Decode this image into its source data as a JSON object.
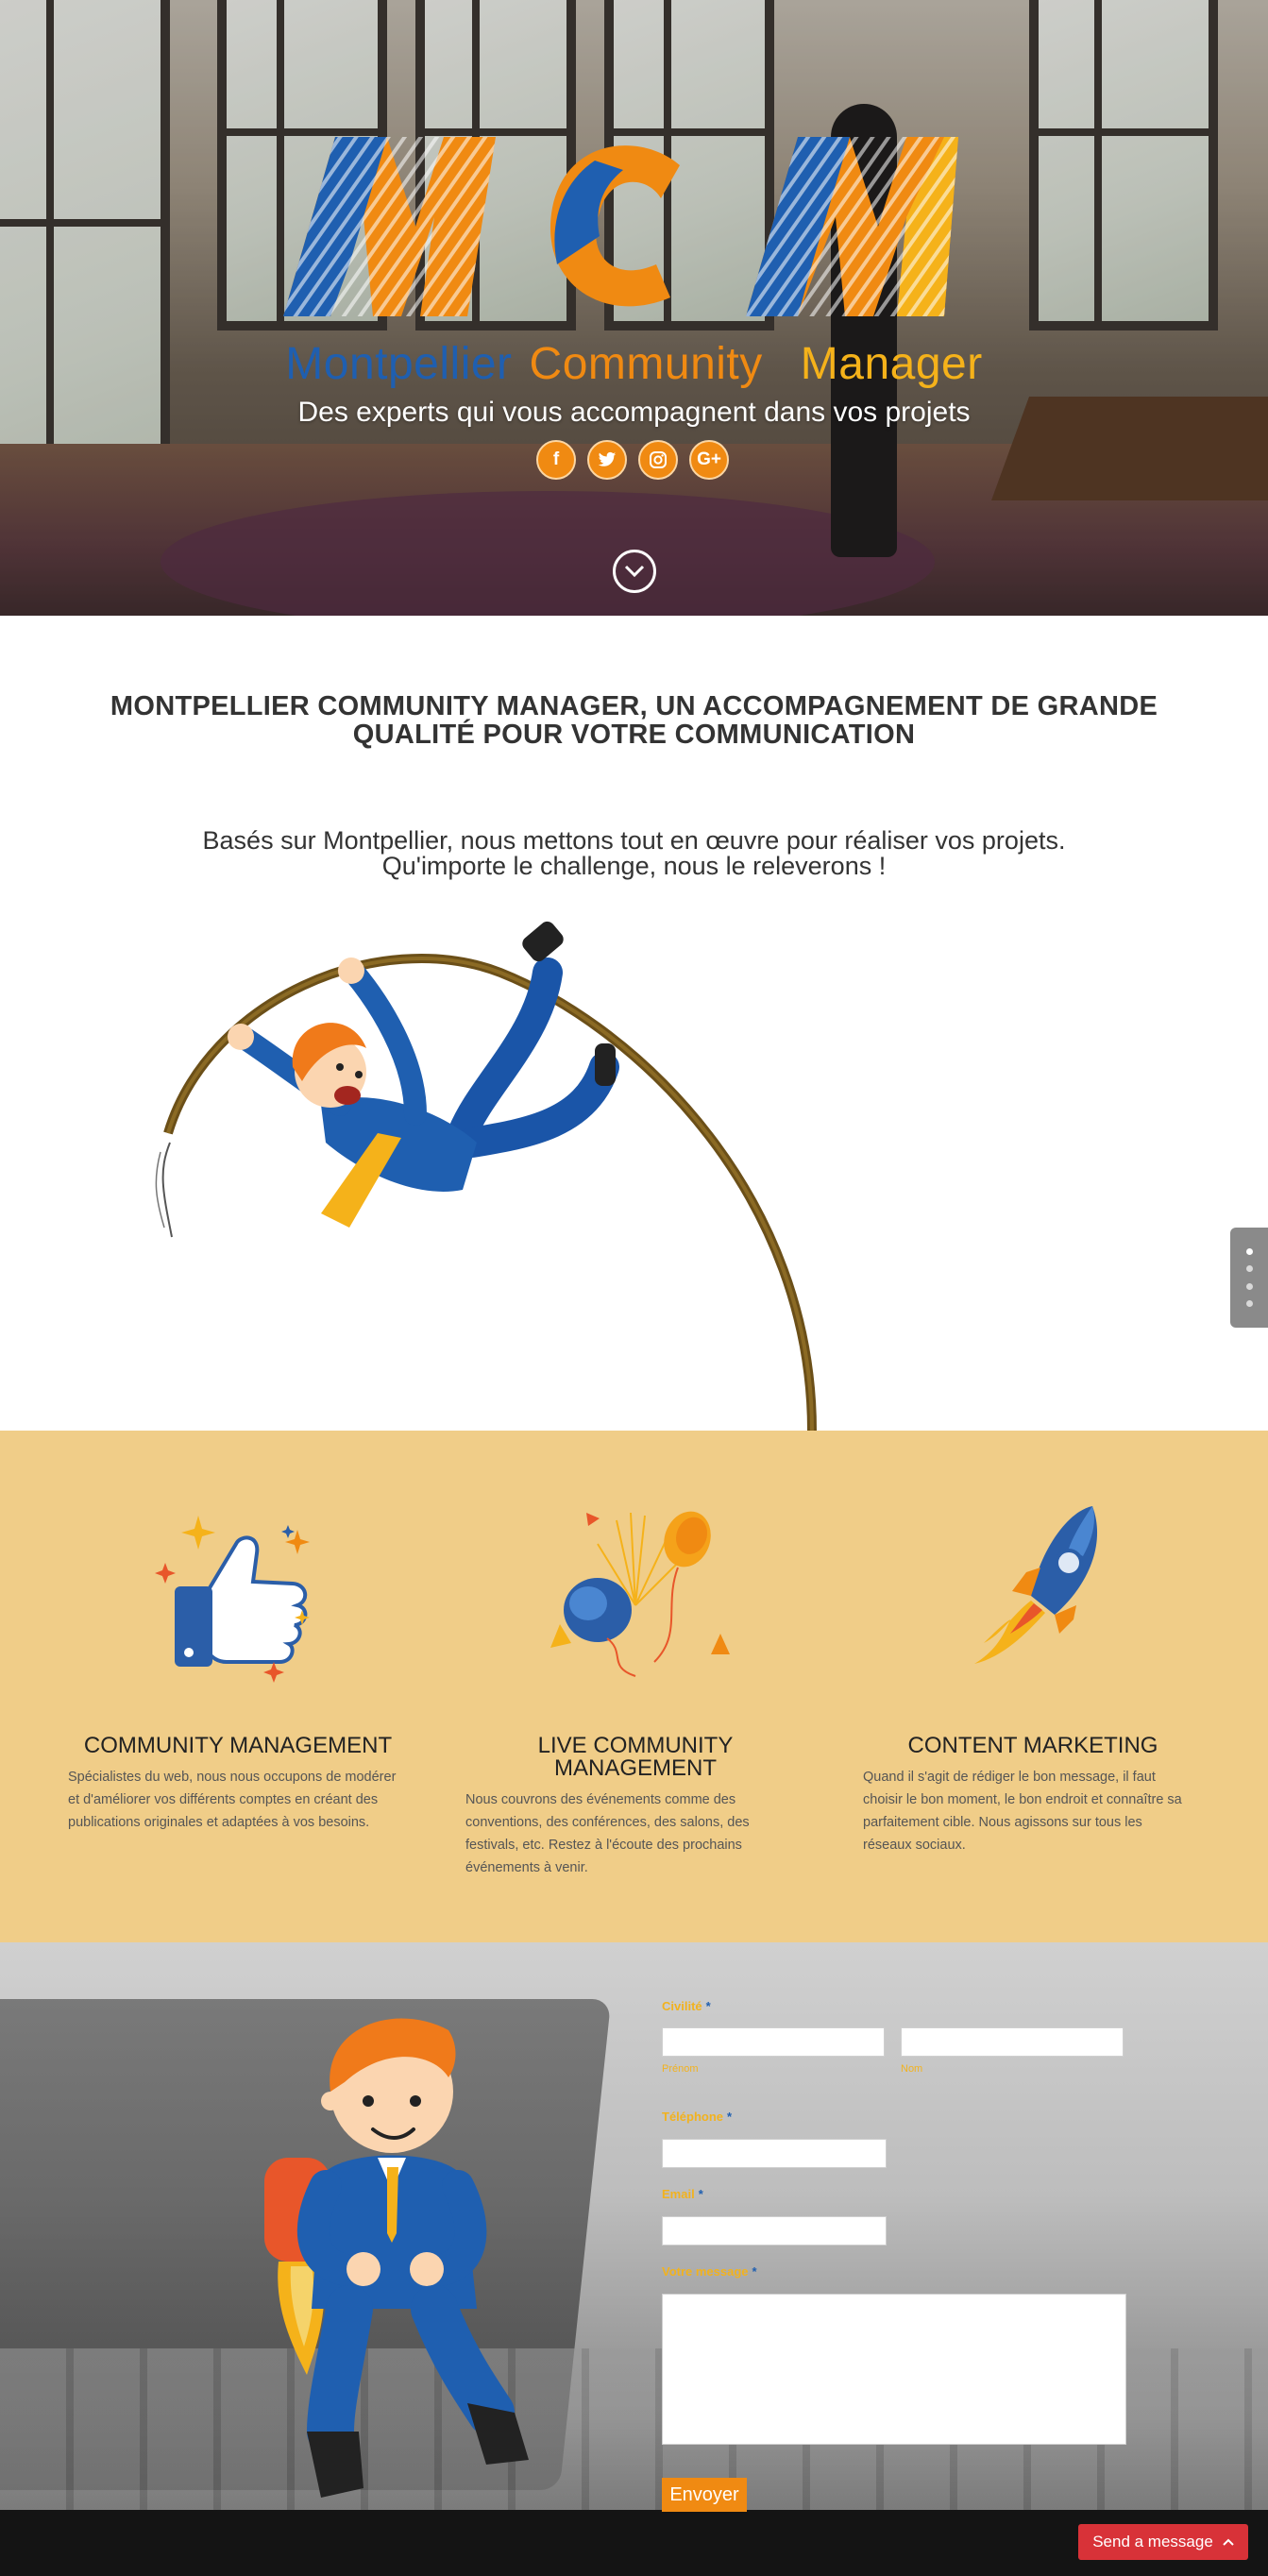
{
  "hero": {
    "logo_text": "MCM",
    "brand_words": [
      "Montpellier",
      "Community",
      "Manager"
    ],
    "tagline": "Des experts qui vous accompagnent dans vos projets",
    "socials": [
      {
        "icon": "facebook-icon",
        "glyph": "f"
      },
      {
        "icon": "twitter-icon",
        "glyph": "t"
      },
      {
        "icon": "instagram-icon",
        "glyph": "◎"
      },
      {
        "icon": "google-plus-icon",
        "glyph": "G+"
      }
    ],
    "scroll_icon": "chevron-down-icon",
    "colors": {
      "blue": "#1f5fb0",
      "orange": "#f08a12",
      "yellow": "#f5b21a"
    }
  },
  "intro": {
    "title_line1": "MONTPELLIER COMMUNITY MANAGER, UN ACCOMPAGNEMENT DE GRANDE",
    "title_line2": "QUALITÉ POUR VOTRE COMMUNICATION",
    "text_line1": "Basés sur Montpellier, nous mettons tout en œuvre pour réaliser vos projets.",
    "text_line2": "Qu'importe le challenge, nous le releverons !"
  },
  "side_nav": {
    "dot_count": 4,
    "active_index": 0
  },
  "services": {
    "background": "#f0cd88",
    "items": [
      {
        "icon": "thumbs-up-icon",
        "title": "COMMUNITY MANAGEMENT",
        "text_lines": [
          "Spécialistes du web, nous nous occupons de modérer",
          "et d'améliorer vos différents comptes en créant des",
          "publications originales et adaptées à vos besoins."
        ]
      },
      {
        "icon": "balloons-icon",
        "title_line1": "LIVE COMMUNITY",
        "title_line2": "MANAGEMENT",
        "text_lines": [
          "Nous couvrons des événements comme des",
          "conventions, des conférences, des salons, des",
          "festivals, etc. Restez à l'écoute des prochains",
          "événements à venir."
        ]
      },
      {
        "icon": "rocket-icon",
        "title": "CONTENT MARKETING",
        "text_lines": [
          "Quand il s'agit de rédiger le bon message, il faut",
          "choisir le bon moment, le bon endroit et connaître sa",
          "parfaitement cible. Nous agissons sur tous les",
          "réseaux sociaux."
        ]
      }
    ]
  },
  "contact_form": {
    "civilite_label": "Civilité",
    "required_mark": "*",
    "prenom_label": "Prénom",
    "nom_label": "Nom",
    "telephone_label": "Téléphone",
    "email_label": "Email",
    "message_label": "Votre message",
    "submit_label": "Envoyer"
  },
  "chat_widget": {
    "label": "Send a message",
    "icon": "chevron-up-icon",
    "color": "#d83238"
  }
}
